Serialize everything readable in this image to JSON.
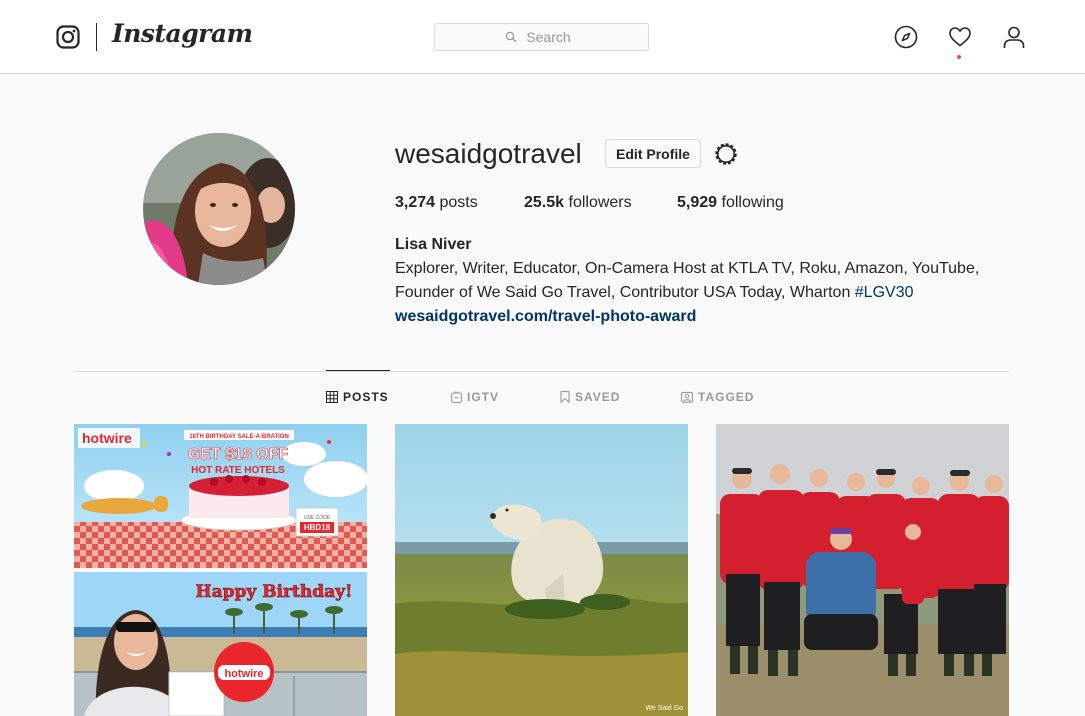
{
  "header": {
    "brand": "Instagram",
    "search_placeholder": "Search"
  },
  "profile": {
    "username": "wesaidgotravel",
    "edit_profile_label": "Edit Profile",
    "stats": {
      "posts_count": "3,274",
      "posts_label": "posts",
      "followers_count": "25.5k",
      "followers_label": "followers",
      "following_count": "5,929",
      "following_label": "following"
    },
    "full_name": "Lisa Niver",
    "bio_line1": "Explorer, Writer, Educator, On-Camera Host at KTLA TV, Roku, Amazon, YouTube,",
    "bio_line2_prefix": "Founder of We Said Go Travel, Contributor USA Today, Wharton ",
    "bio_hashtag": "#LGV30",
    "website": "wesaidgotravel.com/travel-photo-award"
  },
  "tabs": {
    "posts": "POSTS",
    "igtv": "IGTV",
    "saved": "SAVED",
    "tagged": "TAGGED"
  },
  "posts": {
    "hotwire_brand": "hotwire",
    "promo_small": "18TH BIRTHDAY SALE-A-BRATION",
    "promo_title": "GET $18 OFF",
    "promo_subtitle": "HOT RATE HOTELS",
    "promo_code_label": "USE CODE",
    "promo_code": "HBD18",
    "birthday_text": "Happy Birthday!",
    "balloon_text": "hotwire",
    "watermark": "We Said Go"
  },
  "colors": {
    "accent_link": "#003569",
    "notification": "#ed4956",
    "hotwire_red": "#e8262c"
  },
  "icons": [
    "instagram-logo-icon",
    "search-icon",
    "compass-icon",
    "heart-icon",
    "user-icon",
    "settings-gear-icon",
    "grid-icon",
    "igtv-icon",
    "bookmark-icon",
    "tag-person-icon"
  ]
}
